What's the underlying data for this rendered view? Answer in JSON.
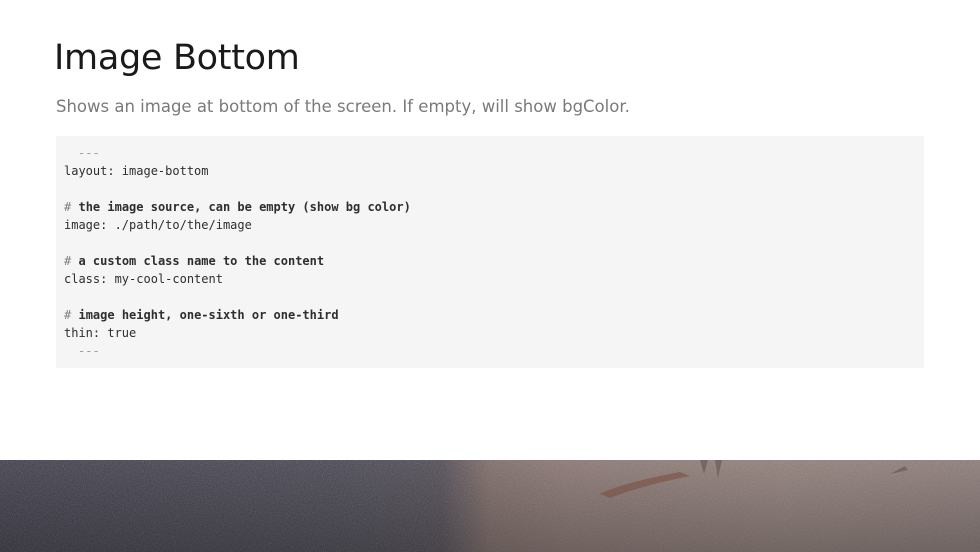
{
  "slide": {
    "title": "Image Bottom",
    "subtitle": "Shows an image at bottom of the screen. If empty, will show bgColor.",
    "code": {
      "separator": "---",
      "lines": [
        {
          "kind": "sep",
          "text": "---"
        },
        {
          "kind": "kv",
          "text": "layout: image-bottom"
        },
        {
          "kind": "blank",
          "text": ""
        },
        {
          "kind": "comment",
          "hash": "#",
          "text": "the image source, can be empty (show bg color)"
        },
        {
          "kind": "kv",
          "text": "image: ./path/to/the/image"
        },
        {
          "kind": "blank",
          "text": ""
        },
        {
          "kind": "comment",
          "hash": "#",
          "text": "a custom class name to the content"
        },
        {
          "kind": "kv",
          "text": "class: my-cool-content"
        },
        {
          "kind": "blank",
          "text": ""
        },
        {
          "kind": "comment",
          "hash": "#",
          "text": "image height, one-sixth or one-third"
        },
        {
          "kind": "kv",
          "text": "thin: true"
        },
        {
          "kind": "sep",
          "text": "---"
        }
      ]
    },
    "bottom_image": {
      "description_icon": "concrete-texture-image",
      "colors": {
        "dark_left": "#3c3c4c",
        "dark_mid": "#4a4858",
        "warm_right": "#8a7570",
        "warm_light": "#9d8882",
        "rust": "#7a4a3a"
      }
    },
    "colors": {
      "title": "#1a1a1a",
      "subtitle": "#7a7a7a",
      "code_bg": "#f5f5f5",
      "code_text": "#2e2e2e",
      "code_muted": "#9a9a9a"
    }
  }
}
